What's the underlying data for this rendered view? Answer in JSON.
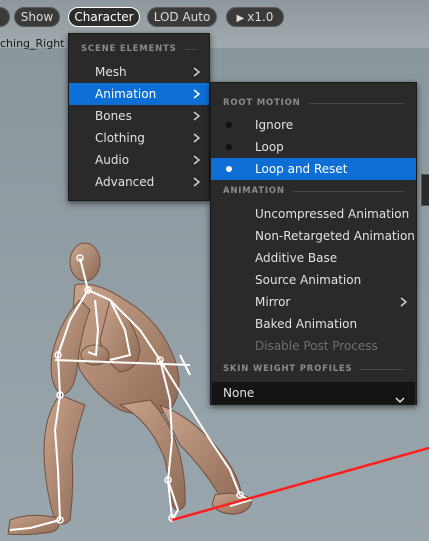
{
  "toolbar": {
    "show_label": "Show",
    "character_label": "Character",
    "lod_label": "LOD Auto",
    "speed_label": "x1.0",
    "play_icon": "play-icon"
  },
  "asset_name": "ching_Right",
  "scene_menu": {
    "header": "SCENE ELEMENTS",
    "items": [
      {
        "label": "Mesh",
        "submenu": true
      },
      {
        "label": "Animation",
        "submenu": true,
        "selected": true
      },
      {
        "label": "Bones",
        "submenu": true
      },
      {
        "label": "Clothing",
        "submenu": true
      },
      {
        "label": "Audio",
        "submenu": true
      },
      {
        "label": "Advanced",
        "submenu": true
      }
    ]
  },
  "animation_menu": {
    "root_motion_header": "ROOT MOTION",
    "root_motion_items": [
      {
        "label": "Ignore"
      },
      {
        "label": "Loop"
      },
      {
        "label": "Loop and Reset",
        "selected": true
      }
    ],
    "animation_header": "ANIMATION",
    "animation_items": [
      {
        "label": "Uncompressed Animation"
      },
      {
        "label": "Non-Retargeted Animation"
      },
      {
        "label": "Additive Base"
      },
      {
        "label": "Source Animation"
      },
      {
        "label": "Mirror",
        "submenu": true
      },
      {
        "label": "Baked Animation"
      },
      {
        "label": "Disable Post Process",
        "disabled": true
      }
    ],
    "skin_weight_header": "SKIN WEIGHT PROFILES",
    "skin_weight_value": "None"
  },
  "colors": {
    "menu_bg": "#2a2a2a",
    "selection": "#0d6fd6",
    "bone_line": "#ffffff",
    "root_line": "#ff1e1e"
  }
}
